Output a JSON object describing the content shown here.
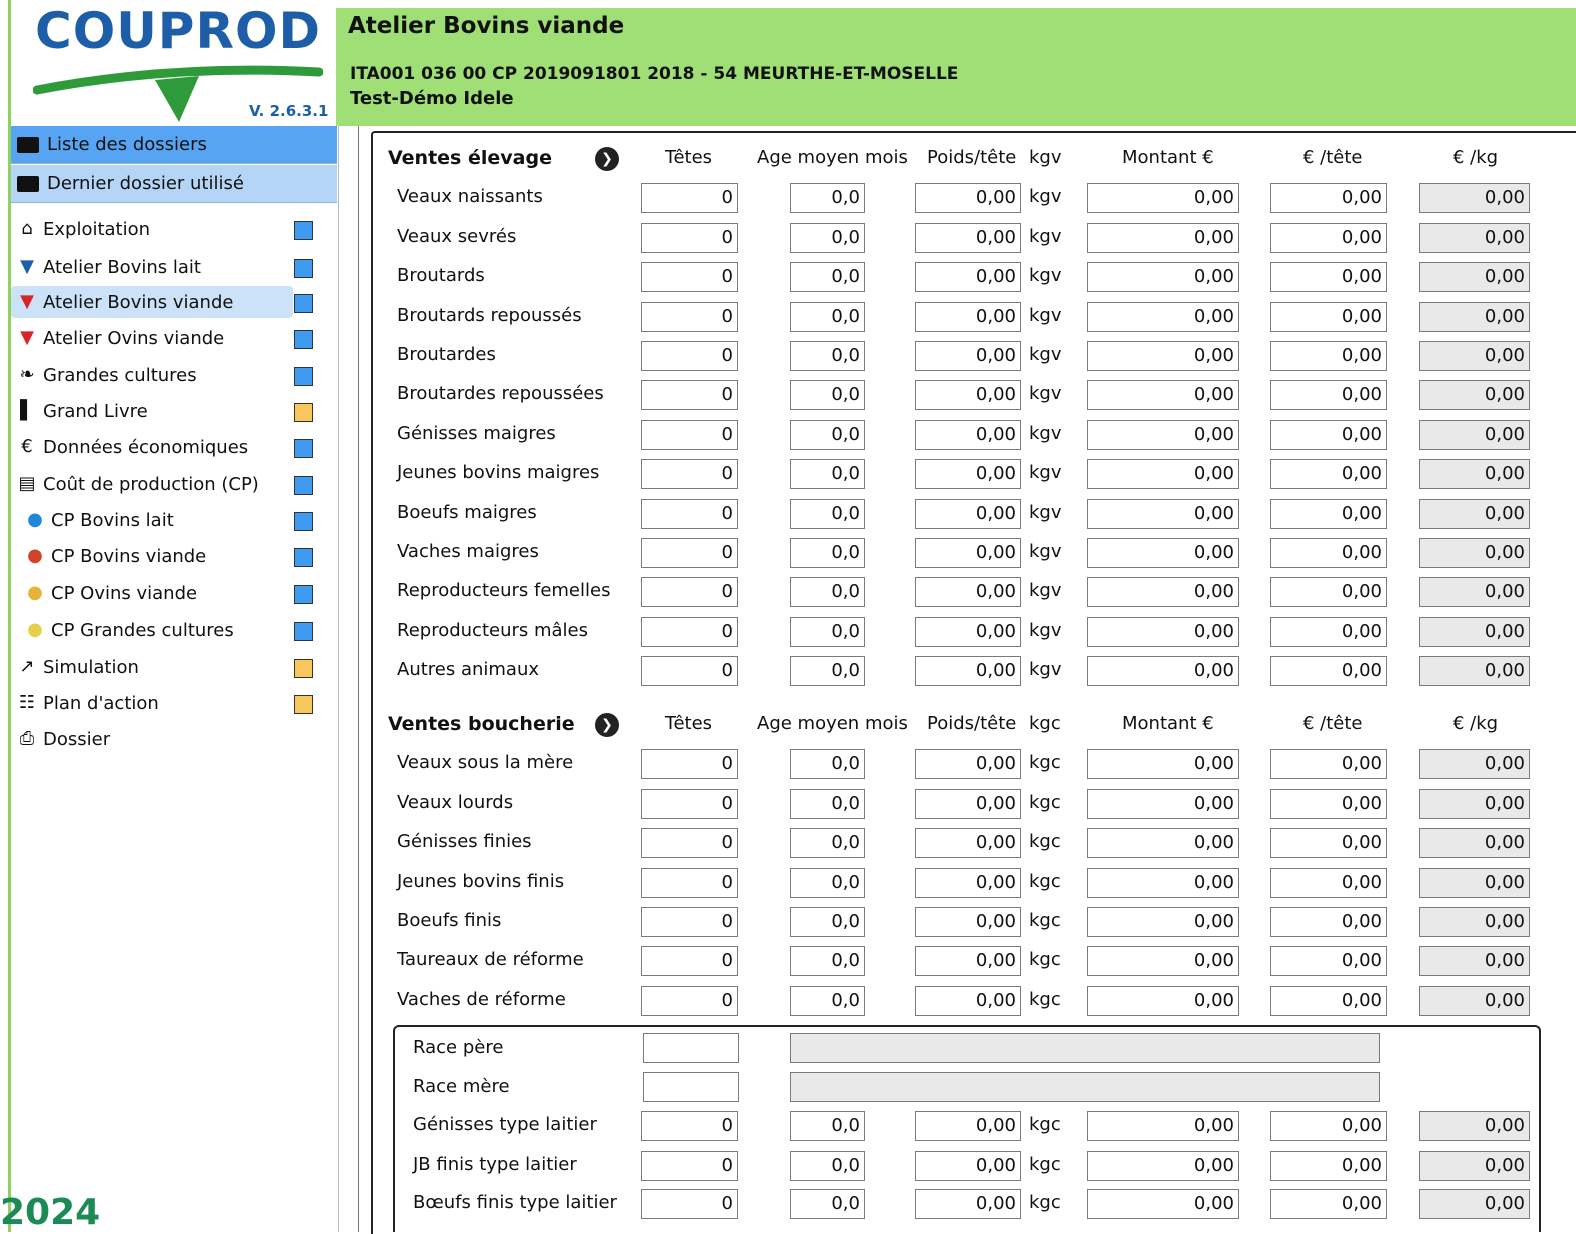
{
  "app": {
    "logo_text": "COUPROD",
    "version": "V. 2.6.3.1",
    "year": "2024"
  },
  "header": {
    "title": "Atelier Bovins viande",
    "line1": "ITA001 036 00 CP 2019091801 2018 - 54  MEURTHE-ET-MOSELLE",
    "line2": "Test-Démo Idele"
  },
  "sidebar": {
    "top_items": [
      {
        "label": "Liste des dossiers",
        "icon": "folder-icon"
      },
      {
        "label": "Dernier dossier utilisé",
        "icon": "folder-icon"
      }
    ],
    "items": [
      {
        "label": "Exploitation",
        "icon": "farm-icon",
        "marker": "blue"
      },
      {
        "label": "Atelier Bovins lait",
        "icon": "cow-blue-icon",
        "marker": "blue"
      },
      {
        "label": "Atelier Bovins viande",
        "icon": "cow-red-icon",
        "marker": "blue",
        "selected": true
      },
      {
        "label": "Atelier Ovins viande",
        "icon": "sheep-red-icon",
        "marker": "blue"
      },
      {
        "label": "Grandes cultures",
        "icon": "crop-icon",
        "marker": "blue"
      },
      {
        "label": "Grand Livre",
        "icon": "book-icon",
        "marker": "orange"
      },
      {
        "label": "Données économiques",
        "icon": "euro-icon",
        "marker": "blue"
      },
      {
        "label": "Coût de production (CP)",
        "icon": "calculator-icon",
        "marker": "blue"
      },
      {
        "label": "CP Bovins lait",
        "icon": "cp-bovins-lait-icon",
        "marker": "blue",
        "sub": true
      },
      {
        "label": "CP Bovins viande",
        "icon": "cp-bovins-viande-icon",
        "marker": "blue",
        "sub": true
      },
      {
        "label": "CP Ovins viande",
        "icon": "cp-ovins-viande-icon",
        "marker": "blue",
        "sub": true
      },
      {
        "label": "CP Grandes cultures",
        "icon": "cp-grandes-cultures-icon",
        "marker": "blue",
        "sub": true
      },
      {
        "label": "Simulation",
        "icon": "chart-line-icon",
        "marker": "orange"
      },
      {
        "label": "Plan d'action",
        "icon": "document-icon",
        "marker": "orange"
      },
      {
        "label": "Dossier",
        "icon": "printer-icon"
      }
    ]
  },
  "colors": {
    "header_bg": "#9fdf76",
    "nav_active": "#57a5f2",
    "nav_top": "#b5d5f7",
    "marker_blue": "#3f9bf0",
    "marker_orange": "#f7c75e",
    "logo_blue": "#1e5ea8",
    "year_green": "#1b8a55"
  },
  "sections": [
    {
      "title": "Ventes élevage",
      "columns": [
        "Têtes",
        "Age moyen mois",
        "Poids/tête",
        "kgv",
        "Montant €",
        "€ /tête",
        "€ /kg"
      ],
      "unit": "kgv",
      "rows": [
        {
          "label": "Veaux naissants",
          "tetes": "0",
          "age": "0,0",
          "poids": "0,00",
          "montant": "0,00",
          "eur_tete": "0,00",
          "eur_kg": "0,00"
        },
        {
          "label": "Veaux sevrés",
          "tetes": "0",
          "age": "0,0",
          "poids": "0,00",
          "montant": "0,00",
          "eur_tete": "0,00",
          "eur_kg": "0,00"
        },
        {
          "label": "Broutards",
          "tetes": "0",
          "age": "0,0",
          "poids": "0,00",
          "montant": "0,00",
          "eur_tete": "0,00",
          "eur_kg": "0,00"
        },
        {
          "label": "Broutards repoussés",
          "tetes": "0",
          "age": "0,0",
          "poids": "0,00",
          "montant": "0,00",
          "eur_tete": "0,00",
          "eur_kg": "0,00"
        },
        {
          "label": "Broutardes",
          "tetes": "0",
          "age": "0,0",
          "poids": "0,00",
          "montant": "0,00",
          "eur_tete": "0,00",
          "eur_kg": "0,00"
        },
        {
          "label": "Broutardes repoussées",
          "tetes": "0",
          "age": "0,0",
          "poids": "0,00",
          "montant": "0,00",
          "eur_tete": "0,00",
          "eur_kg": "0,00"
        },
        {
          "label": "Génisses maigres",
          "tetes": "0",
          "age": "0,0",
          "poids": "0,00",
          "montant": "0,00",
          "eur_tete": "0,00",
          "eur_kg": "0,00"
        },
        {
          "label": "Jeunes bovins maigres",
          "tetes": "0",
          "age": "0,0",
          "poids": "0,00",
          "montant": "0,00",
          "eur_tete": "0,00",
          "eur_kg": "0,00"
        },
        {
          "label": "Boeufs maigres",
          "tetes": "0",
          "age": "0,0",
          "poids": "0,00",
          "montant": "0,00",
          "eur_tete": "0,00",
          "eur_kg": "0,00"
        },
        {
          "label": "Vaches maigres",
          "tetes": "0",
          "age": "0,0",
          "poids": "0,00",
          "montant": "0,00",
          "eur_tete": "0,00",
          "eur_kg": "0,00"
        },
        {
          "label": "Reproducteurs femelles",
          "tetes": "0",
          "age": "0,0",
          "poids": "0,00",
          "montant": "0,00",
          "eur_tete": "0,00",
          "eur_kg": "0,00"
        },
        {
          "label": "Reproducteurs mâles",
          "tetes": "0",
          "age": "0,0",
          "poids": "0,00",
          "montant": "0,00",
          "eur_tete": "0,00",
          "eur_kg": "0,00"
        },
        {
          "label": "Autres animaux",
          "tetes": "0",
          "age": "0,0",
          "poids": "0,00",
          "montant": "0,00",
          "eur_tete": "0,00",
          "eur_kg": "0,00"
        }
      ]
    },
    {
      "title": "Ventes boucherie",
      "columns": [
        "Têtes",
        "Age moyen mois",
        "Poids/tête",
        "kgc",
        "Montant €",
        "€ /tête",
        "€ /kg"
      ],
      "unit": "kgc",
      "rows": [
        {
          "label": "Veaux sous la mère",
          "tetes": "0",
          "age": "0,0",
          "poids": "0,00",
          "montant": "0,00",
          "eur_tete": "0,00",
          "eur_kg": "0,00"
        },
        {
          "label": "Veaux lourds",
          "tetes": "0",
          "age": "0,0",
          "poids": "0,00",
          "montant": "0,00",
          "eur_tete": "0,00",
          "eur_kg": "0,00"
        },
        {
          "label": "Génisses finies",
          "tetes": "0",
          "age": "0,0",
          "poids": "0,00",
          "montant": "0,00",
          "eur_tete": "0,00",
          "eur_kg": "0,00"
        },
        {
          "label": "Jeunes bovins finis",
          "tetes": "0",
          "age": "0,0",
          "poids": "0,00",
          "montant": "0,00",
          "eur_tete": "0,00",
          "eur_kg": "0,00"
        },
        {
          "label": "Boeufs finis",
          "tetes": "0",
          "age": "0,0",
          "poids": "0,00",
          "montant": "0,00",
          "eur_tete": "0,00",
          "eur_kg": "0,00"
        },
        {
          "label": "Taureaux de réforme",
          "tetes": "0",
          "age": "0,0",
          "poids": "0,00",
          "montant": "0,00",
          "eur_tete": "0,00",
          "eur_kg": "0,00"
        },
        {
          "label": "Vaches de réforme",
          "tetes": "0",
          "age": "0,0",
          "poids": "0,00",
          "montant": "0,00",
          "eur_tete": "0,00",
          "eur_kg": "0,00"
        }
      ]
    }
  ],
  "race": {
    "pere_label": "Race père",
    "pere_code": "",
    "pere_name": "",
    "mere_label": "Race mère",
    "mere_code": "",
    "mere_name": "",
    "unit": "kgc",
    "rows": [
      {
        "label": "Génisses type laitier",
        "tetes": "0",
        "age": "0,0",
        "poids": "0,00",
        "montant": "0,00",
        "eur_tete": "0,00",
        "eur_kg": "0,00"
      },
      {
        "label": "JB finis type laitier",
        "tetes": "0",
        "age": "0,0",
        "poids": "0,00",
        "montant": "0,00",
        "eur_tete": "0,00",
        "eur_kg": "0,00"
      },
      {
        "label": "Bœufs finis type laitier",
        "tetes": "0",
        "age": "0,0",
        "poids": "0,00",
        "montant": "0,00",
        "eur_tete": "0,00",
        "eur_kg": "0,00"
      }
    ]
  }
}
